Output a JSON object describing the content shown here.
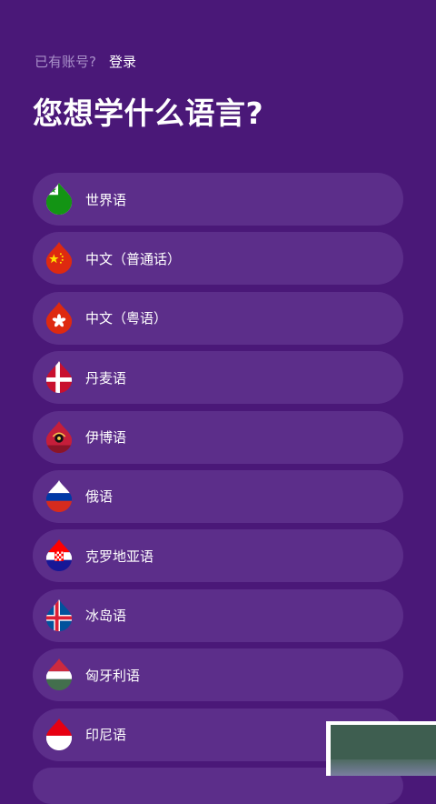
{
  "header": {
    "account_prompt": "已有账号?",
    "login_label": "登录",
    "title": "您想学什么语言?"
  },
  "languages": [
    {
      "label": "世界语",
      "flag": "esperanto-flag-icon"
    },
    {
      "label": "中文（普通话）",
      "flag": "china-flag-icon"
    },
    {
      "label": "中文（粤语）",
      "flag": "hong-kong-flag-icon"
    },
    {
      "label": "丹麦语",
      "flag": "denmark-flag-icon"
    },
    {
      "label": "伊博语",
      "flag": "igbo-flag-icon"
    },
    {
      "label": "俄语",
      "flag": "russia-flag-icon"
    },
    {
      "label": "克罗地亚语",
      "flag": "croatia-flag-icon"
    },
    {
      "label": "冰岛语",
      "flag": "iceland-flag-icon"
    },
    {
      "label": "匈牙利语",
      "flag": "hungary-flag-icon"
    },
    {
      "label": "印尼语",
      "flag": "indonesia-flag-icon"
    }
  ],
  "colors": {
    "background": "#4a1878",
    "item_background": "#5c2e8a",
    "prompt_text": "#a990c9"
  }
}
